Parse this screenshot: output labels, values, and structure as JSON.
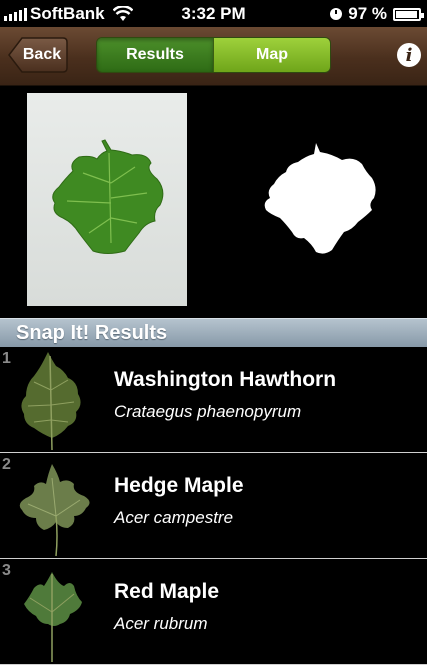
{
  "status": {
    "carrier": "SoftBank",
    "time": "3:32 PM",
    "battery": "97 %",
    "battery_level": 0.97,
    "icons": [
      "signal-bars-icon",
      "wifi-icon",
      "clock-icon",
      "battery-icon"
    ]
  },
  "nav": {
    "back_label": "Back",
    "tabs": [
      "Results",
      "Map"
    ],
    "selected_tab": "Results",
    "info_icon": "info-icon"
  },
  "section_title": "Snap It! Results",
  "results": [
    {
      "rank": "1",
      "common": "Washington Hawthorn",
      "latin": "Crataegus phaenopyrum"
    },
    {
      "rank": "2",
      "common": "Hedge Maple",
      "latin": "Acer campestre"
    },
    {
      "rank": "3",
      "common": "Red Maple",
      "latin": "Acer rubrum"
    }
  ],
  "colors": {
    "nav_brown": "#4a2f1d",
    "segment_selected": "#3a7a1e",
    "segment_unselected": "#8cc42c",
    "section_header": "#9eadb9"
  }
}
